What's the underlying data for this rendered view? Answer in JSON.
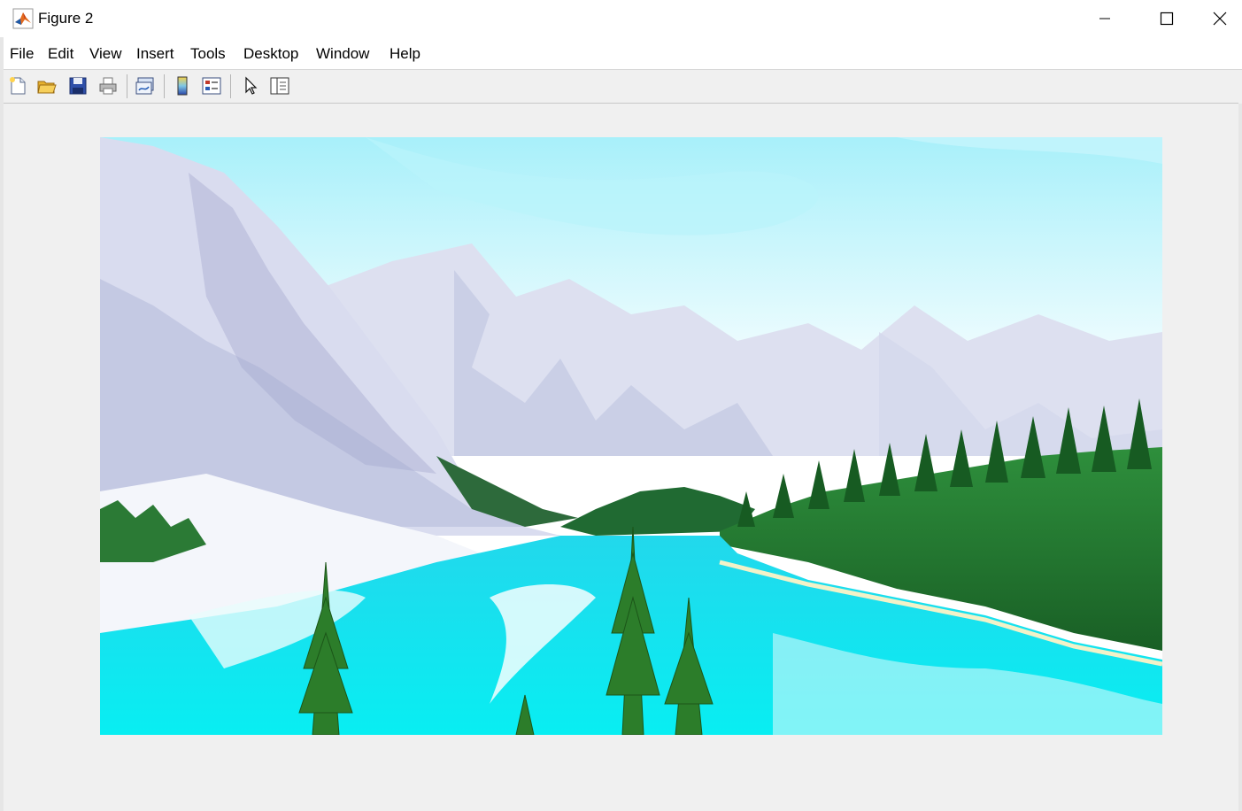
{
  "window": {
    "title": "Figure 2",
    "app_icon": "matlab-icon",
    "controls": [
      "minimize-icon",
      "maximize-icon",
      "close-icon"
    ]
  },
  "menu": {
    "items": [
      "File",
      "Edit",
      "View",
      "Insert",
      "Tools",
      "Desktop",
      "Window",
      "Help"
    ]
  },
  "toolbar": {
    "buttons": [
      "new-figure-icon",
      "open-file-icon",
      "save-icon",
      "print-icon",
      "link-plot-icon",
      "insert-colorbar-icon",
      "insert-legend-icon",
      "edit-plot-icon",
      "property-inspector-icon"
    ]
  },
  "figure": {
    "image_description_icon": "image-display",
    "colors": {
      "sky": "#b8f3fb",
      "mountain": "#c9cde8",
      "lake": "#14e4ee",
      "forest": "#1f7a30"
    }
  }
}
